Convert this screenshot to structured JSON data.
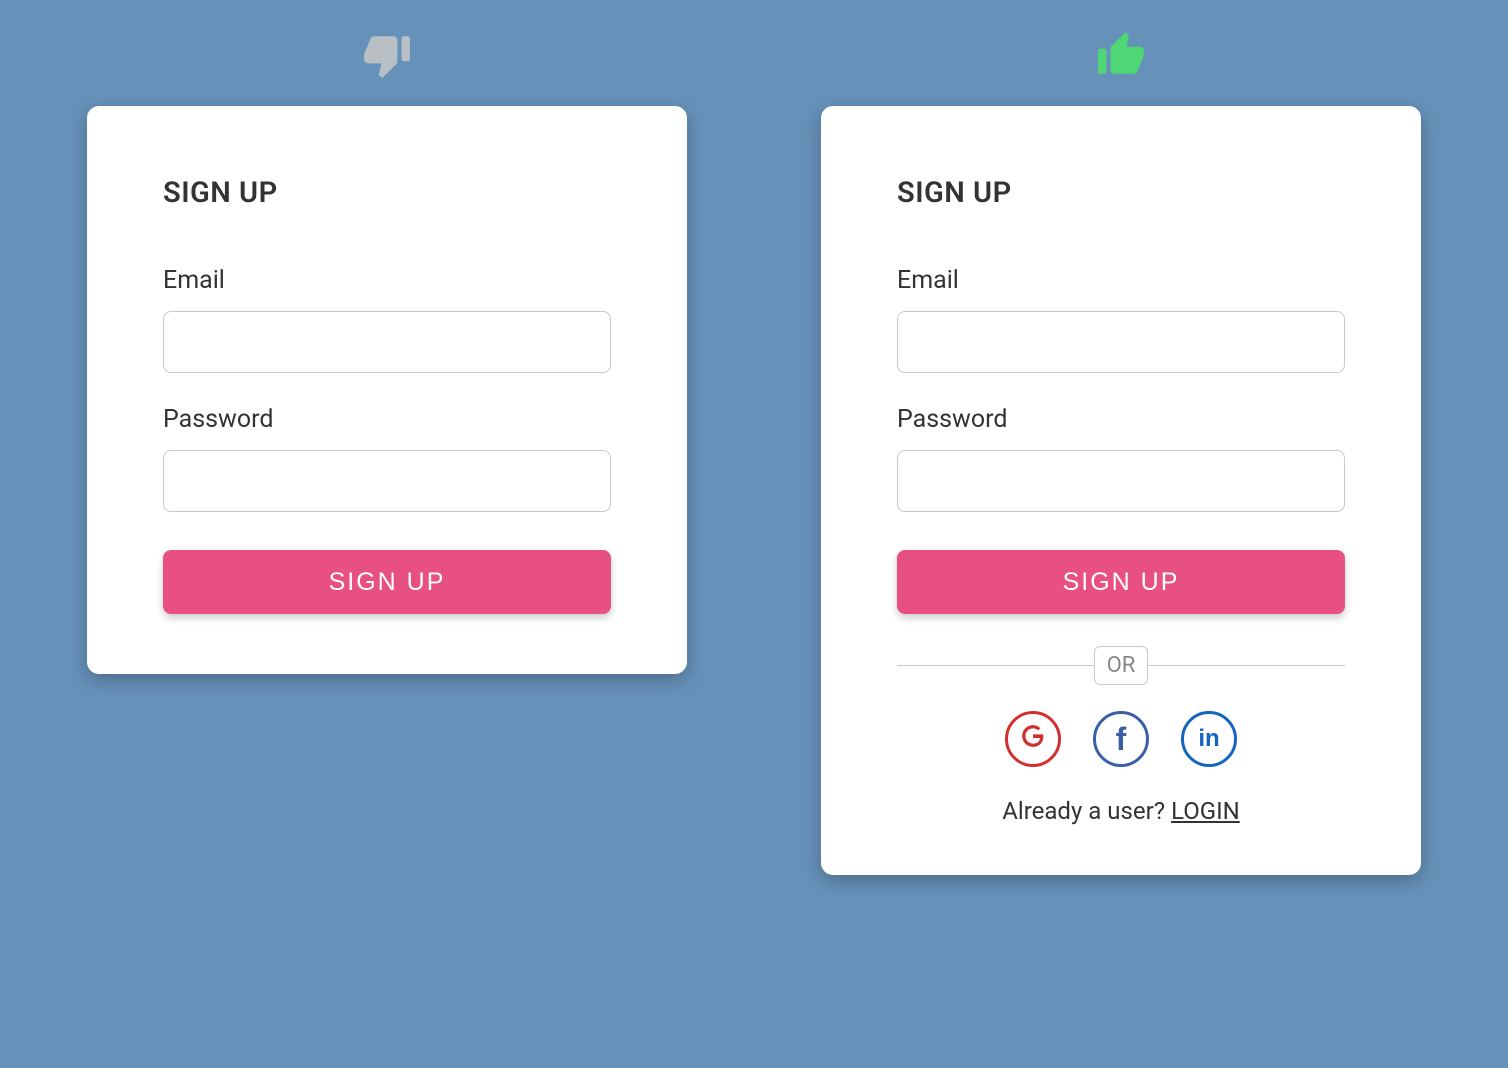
{
  "left": {
    "heading": "SIGN UP",
    "email_label": "Email",
    "password_label": "Password",
    "button_label": "SIGN UP"
  },
  "right": {
    "heading": "SIGN UP",
    "email_label": "Email",
    "password_label": "Password",
    "button_label": "SIGN UP",
    "divider_text": "OR",
    "already_text": "Already a user? ",
    "login_label": "LOGIN"
  },
  "icons": {
    "thumbs_down": "thumbs-down",
    "thumbs_up": "thumbs-up",
    "google": "G",
    "facebook": "f",
    "linkedin": "in"
  },
  "colors": {
    "bg": "#6691b9",
    "accent": "#e85082",
    "thumbs_up": "#4fd675",
    "thumbs_down": "#b8c0c6",
    "google": "#d32f2f",
    "facebook": "#3b5fa6",
    "linkedin": "#1565c0"
  }
}
